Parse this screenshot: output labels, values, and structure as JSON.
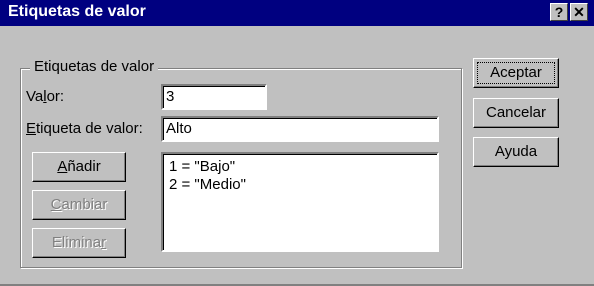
{
  "window": {
    "title": "Etiquetas de valor",
    "help_glyph": "?",
    "close_glyph": "✕"
  },
  "group": {
    "legend": "Etiquetas de valor"
  },
  "value_field": {
    "label_pre": "Va",
    "label_underline": "l",
    "label_post": "or:",
    "value": "3"
  },
  "label_field": {
    "label_underline": "E",
    "label_post": "tiqueta de valor:",
    "value": "Alto"
  },
  "buttons": {
    "add_underline": "A",
    "add_post": "ñadir",
    "change_underline": "C",
    "change_post": "ambiar",
    "remove_pre": "Elimina",
    "remove_underline": "r",
    "accept": "Aceptar",
    "cancel": "Cancelar",
    "help": "Ayuda"
  },
  "value_labels": [
    "1 = \"Bajo\"",
    "2 = \"Medio\""
  ]
}
